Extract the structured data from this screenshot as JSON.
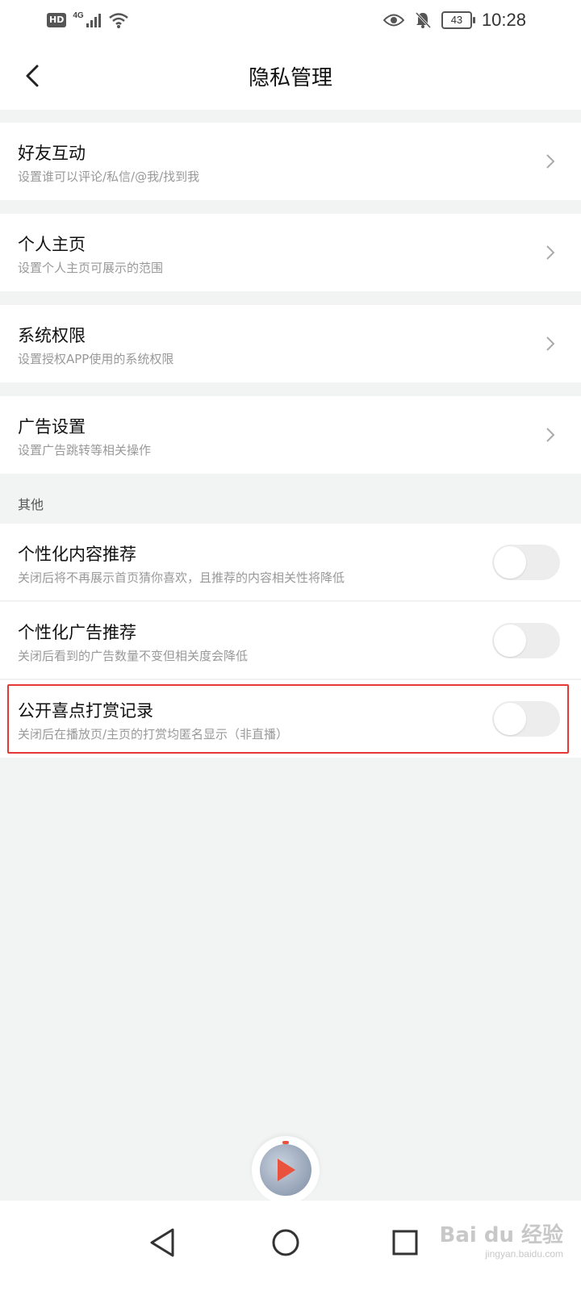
{
  "status_bar": {
    "network_badge": "HD",
    "network_type": "4G",
    "battery_level": "43",
    "time": "10:28",
    "icons": [
      "signal-icon",
      "wifi-icon",
      "eye-icon",
      "bell-muted-icon",
      "battery-icon"
    ]
  },
  "header": {
    "title": "隐私管理",
    "back_icon": "chevron-left-icon"
  },
  "menu_items": [
    {
      "title": "好友互动",
      "subtitle": "设置谁可以评论/私信/@我/找到我"
    },
    {
      "title": "个人主页",
      "subtitle": "设置个人主页可展示的范围"
    },
    {
      "title": "系统权限",
      "subtitle": "设置授权APP使用的系统权限"
    },
    {
      "title": "广告设置",
      "subtitle": "设置广告跳转等相关操作"
    }
  ],
  "other_section": {
    "label": "其他",
    "toggles": [
      {
        "title": "个性化内容推荐",
        "subtitle": "关闭后将不再展示首页猜你喜欢，且推荐的内容相关性将降低",
        "on": false
      },
      {
        "title": "个性化广告推荐",
        "subtitle": "关闭后看到的广告数量不变但相关度会降低",
        "on": false
      },
      {
        "title": "公开喜点打赏记录",
        "subtitle": "关闭后在播放页/主页的打赏均匿名显示（非直播）",
        "on": false,
        "highlighted": true
      }
    ]
  },
  "colors": {
    "page_background": "#f2f3f3",
    "highlight_border": "#e53935",
    "toggle_off": "#ededed",
    "mini_player_accent": "#e9523d"
  },
  "mini_player": {
    "icon": "play-icon"
  },
  "system_nav": {
    "buttons": [
      "back-triangle-icon",
      "home-circle-icon",
      "recents-square-icon"
    ]
  },
  "watermark": {
    "logo": "Bai du 经验",
    "url": "jingyan.baidu.com"
  }
}
